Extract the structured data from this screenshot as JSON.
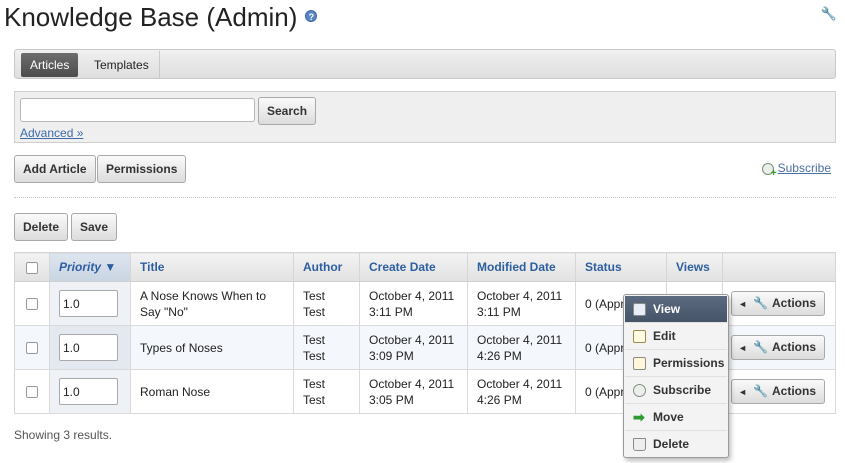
{
  "page": {
    "title": "Knowledge Base (Admin)",
    "help_icon": "?"
  },
  "icons": {
    "help": "help-circle-icon",
    "settings": "wrench-icon",
    "subscribe": "subscribe-icon"
  },
  "tabs": [
    {
      "label": "Articles",
      "active": true
    },
    {
      "label": "Templates",
      "active": false
    }
  ],
  "search": {
    "value": "",
    "placeholder": "",
    "button_label": "Search",
    "advanced_label": "Advanced »"
  },
  "toolbar": {
    "add_article_label": "Add Article",
    "permissions_label": "Permissions",
    "subscribe_label": "Subscribe",
    "delete_label": "Delete",
    "save_label": "Save"
  },
  "table": {
    "columns": [
      "Priority ▼",
      "Title",
      "Author",
      "Create Date",
      "Modified Date",
      "Status",
      "Views"
    ],
    "rows": [
      {
        "priority": "1.0",
        "title": "A Nose Knows When to Say \"No\"",
        "author": "Test Test",
        "created": "October 4, 2011 3:11 PM",
        "modified": "October 4, 2011 3:11 PM",
        "status": "0 (Approved)",
        "actions": "Actions"
      },
      {
        "priority": "1.0",
        "title": "Types of Noses",
        "author": "Test Test",
        "created": "October 4, 2011 3:09 PM",
        "modified": "October 4, 2011 4:26 PM",
        "status": "0 (Approved)",
        "actions": "Actions"
      },
      {
        "priority": "1.0",
        "title": "Roman Nose",
        "author": "Test Test",
        "created": "October 4, 2011 3:05 PM",
        "modified": "October 4, 2011 4:26 PM",
        "status": "0 (Approved)",
        "actions": "Actions"
      }
    ]
  },
  "footer": {
    "results_text": "Showing 3 results."
  },
  "context_menu": {
    "items": [
      {
        "label": "View",
        "icon": "view-icon",
        "highlighted": true
      },
      {
        "label": "Edit",
        "icon": "edit-icon"
      },
      {
        "label": "Permissions",
        "icon": "permissions-icon"
      },
      {
        "label": "Subscribe",
        "icon": "subscribe-icon"
      },
      {
        "label": "Move",
        "icon": "move-arrow-icon"
      },
      {
        "label": "Delete",
        "icon": "trash-icon"
      }
    ]
  },
  "colors": {
    "link": "#3a6aa8",
    "header_text": "#2d5fa0",
    "active_tab": "#555555",
    "menu_highlight": "#4f5d72"
  }
}
